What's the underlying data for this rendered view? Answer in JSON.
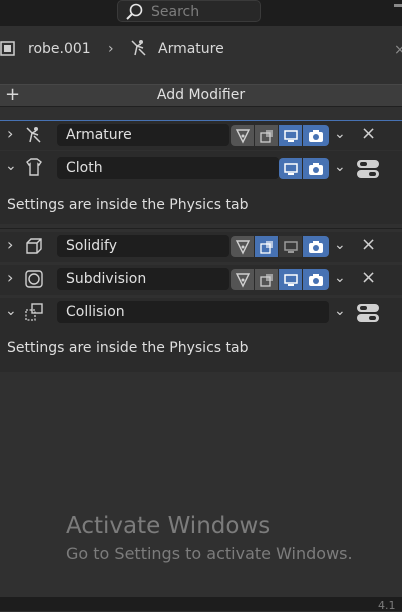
{
  "header": {
    "search_placeholder": "Search",
    "object_name": "robe.001",
    "context_name": "Armature"
  },
  "add_modifier_label": "Add Modifier",
  "modifiers": [
    {
      "name": "Armature",
      "expanded": false,
      "icon": "armature-icon"
    },
    {
      "name": "Cloth",
      "expanded": true,
      "icon": "cloth-icon",
      "note": "Settings are inside the Physics tab"
    },
    {
      "name": "Solidify",
      "expanded": false,
      "icon": "solidify-icon"
    },
    {
      "name": "Subdivision",
      "expanded": false,
      "icon": "subdivision-icon"
    },
    {
      "name": "Collision",
      "expanded": true,
      "icon": "collision-icon",
      "note": "Settings are inside the Physics tab"
    }
  ],
  "watermark": {
    "title": "Activate Windows",
    "subtitle": "Go to Settings to activate Windows."
  },
  "version": "4.1",
  "colors": {
    "accent": "#4772b3",
    "panel": "#2b2b2b",
    "field": "#1e1e1e"
  }
}
